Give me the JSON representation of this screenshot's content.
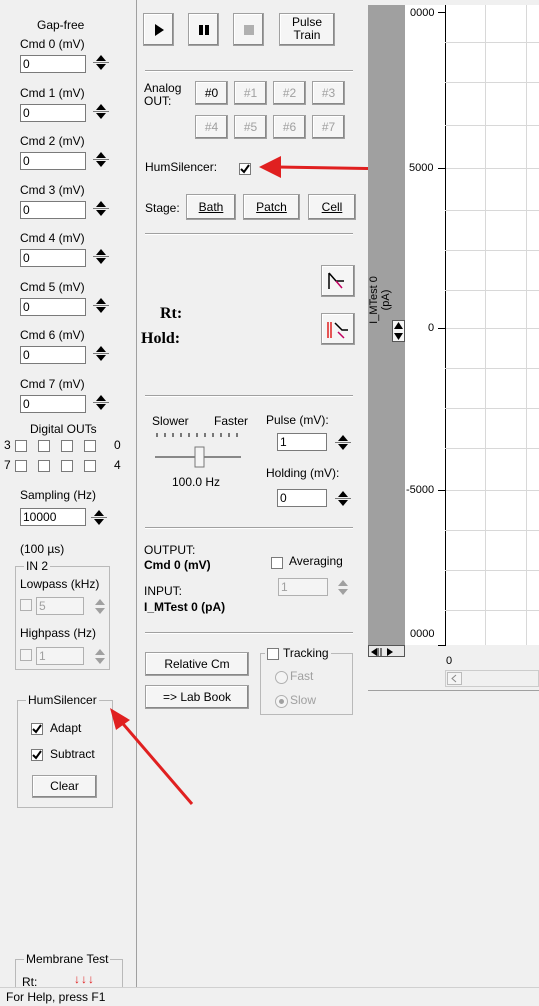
{
  "left": {
    "mode": "Gap-free",
    "cmds": [
      {
        "label": "Cmd 0 (mV)",
        "value": "0"
      },
      {
        "label": "Cmd 1 (mV)",
        "value": "0"
      },
      {
        "label": "Cmd 2 (mV)",
        "value": "0"
      },
      {
        "label": "Cmd 3 (mV)",
        "value": "0"
      },
      {
        "label": "Cmd 4 (mV)",
        "value": "0"
      },
      {
        "label": "Cmd 5 (mV)",
        "value": "0"
      },
      {
        "label": "Cmd 6 (mV)",
        "value": "0"
      },
      {
        "label": "Cmd 7 (mV)",
        "value": "0"
      }
    ],
    "digital_outs_label": "Digital OUTs",
    "dig_row1_left": "3",
    "dig_row1_right": "0",
    "dig_row2_left": "7",
    "dig_row2_right": "4",
    "sampling_label": "Sampling (Hz)",
    "sampling_value": "10000",
    "sampling_period": "(100 µs)",
    "in2_title": "IN 2",
    "lowpass_label": "Lowpass (kHz)",
    "lowpass_value": "5",
    "highpass_label": "Highpass (Hz)",
    "highpass_value": "1",
    "humsilencer_title": "HumSilencer",
    "adapt_label": "Adapt",
    "subtract_label": "Subtract",
    "clear_label": "Clear",
    "membrane_title": "Membrane Test",
    "rt_label": "Rt:",
    "rt_value": "↓↓↓"
  },
  "mid": {
    "pulse_train_label": "Pulse\nTrain",
    "analog_out_label": "Analog\nOUT:",
    "analog_channels": [
      "#0",
      "#1",
      "#2",
      "#3",
      "#4",
      "#5",
      "#6",
      "#7"
    ],
    "humsilencer_label": "HumSilencer:",
    "stage_label": "Stage:",
    "stage_buttons": [
      "Bath",
      "Patch",
      "Cell"
    ],
    "rt_label": "Rt:",
    "hold_label": "Hold:",
    "slower_label": "Slower",
    "faster_label": "Faster",
    "freq_value": "100.0 Hz",
    "pulse_label": "Pulse (mV):",
    "pulse_value": "1",
    "holding_label": "Holding (mV):",
    "holding_value": "0",
    "output_label": "OUTPUT:",
    "output_value": "Cmd 0 (mV)",
    "input_label": "INPUT:",
    "input_value": "I_MTest 0 (pA)",
    "averaging_label": "Averaging",
    "averaging_value": "1",
    "relative_cm_label": "Relative Cm",
    "lab_book_label": "=> Lab Book",
    "tracking_label": "Tracking",
    "fast_label": "Fast",
    "slow_label": "Slow"
  },
  "plot": {
    "axis_label": "I_MTest 0\n(pA)",
    "y_top": "0000",
    "y_5000": "5000",
    "y_0": "0",
    "y_neg5000": "-5000",
    "y_bottom": "0000",
    "x_start": "0"
  },
  "status": {
    "text": "For Help, press F1"
  },
  "colors": {
    "arrow": "#e02020",
    "axis_strip": "#a0a0a0"
  }
}
